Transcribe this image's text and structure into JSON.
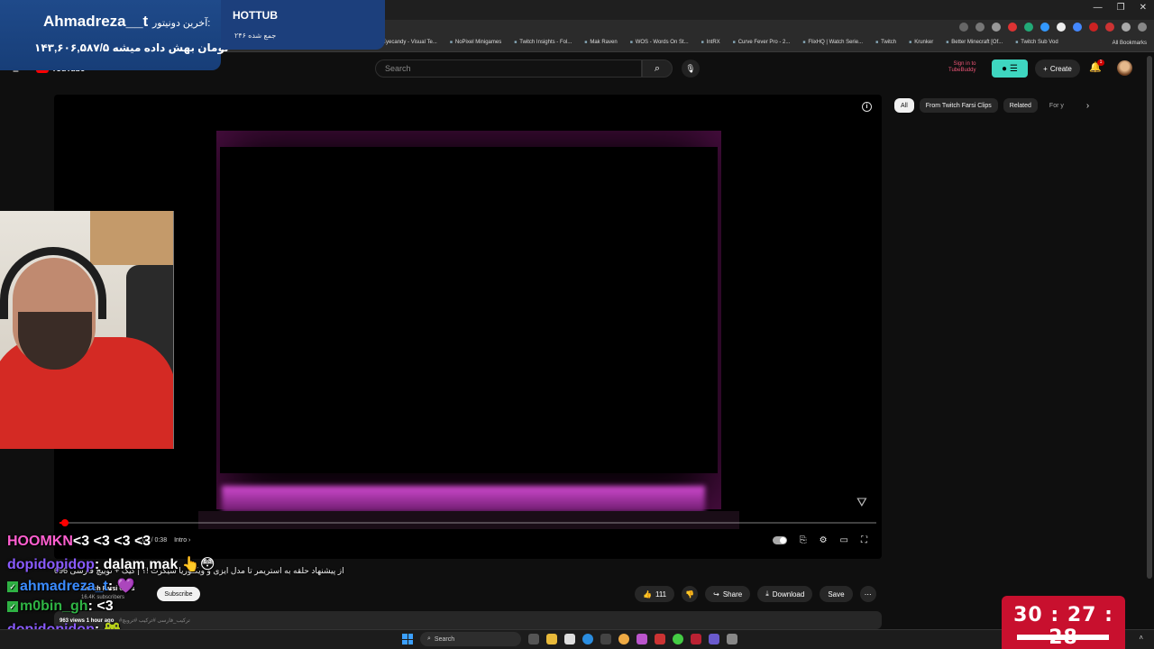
{
  "browser": {
    "bookmarks": [
      "Eyecandy - Visual Te...",
      "NoPixel Minigames",
      "Twitch Insights - Fol...",
      "Mak Raven",
      "WOS - Words On St...",
      "IntRX",
      "Curve Fever Pro - 2...",
      "FlixHQ | Watch Serie...",
      "Twitch",
      "Krunker",
      "Better Minecraft [Of...",
      "Twitch Sub Vod"
    ],
    "all_bookmarks": "All Bookmarks"
  },
  "youtube": {
    "logo_text": "YouTube",
    "search_placeholder": "Search",
    "tubebuddy_line1": "Sign in to",
    "tubebuddy_line2": "TubeBuddy",
    "create_label": "Create",
    "notification_count": "1",
    "chips": [
      "All",
      "From Twitch Farsi Clips",
      "Related",
      "For y"
    ],
    "video": {
      "progress_fraction": 0.007,
      "time_text": "0:03 / 0:38",
      "chapter": "Intro"
    },
    "channel_name": "Twitch Farsi Clips",
    "subscribers": "16.4K subscribers",
    "subscribe_label": "Subscribe",
    "likes": "111",
    "share_label": "Share",
    "download_label": "Download",
    "save_label": "Save",
    "views": "963 views",
    "posted": "1 hour ago",
    "tags": "#ترکیب_فارسی #ترکیب #تروبچ"
  },
  "overlay": {
    "donor_label": "آخرین دونیتور:",
    "donor_name": "Ahmadreza__t",
    "donation_amount": "۱۴۳,۶۰۶,۵۸۷/۵ تومان بهش داده میشه",
    "hottub_title": "HOTTUB",
    "hottub_sub": "۲۴۶ جمع شده",
    "persian_title": "از پیشنهاد حلقه به استریمر تا مدل ایزی و ویکتوریا سیکرت !؟ | کیک + توییچ فارسی 696",
    "chat": [
      {
        "user": "HOOMKN",
        "msg": "<3 <3 <3 <3",
        "color": "#ff5fd0"
      },
      {
        "user": "dopidopidop",
        "msg": "dalam mak 👆😳",
        "color": "#8a5bff"
      },
      {
        "user": "ahmadreza_t",
        "msg": "💜",
        "color": "#3a8bff"
      },
      {
        "user": "m0bin_gh",
        "msg": "<3",
        "color": "#2fb344"
      },
      {
        "user": "dopidopidop",
        "msg": "🐸",
        "color": "#8a5bff"
      }
    ],
    "timer": "30 : 27 : 28"
  },
  "taskbar": {
    "search_label": "Search"
  }
}
